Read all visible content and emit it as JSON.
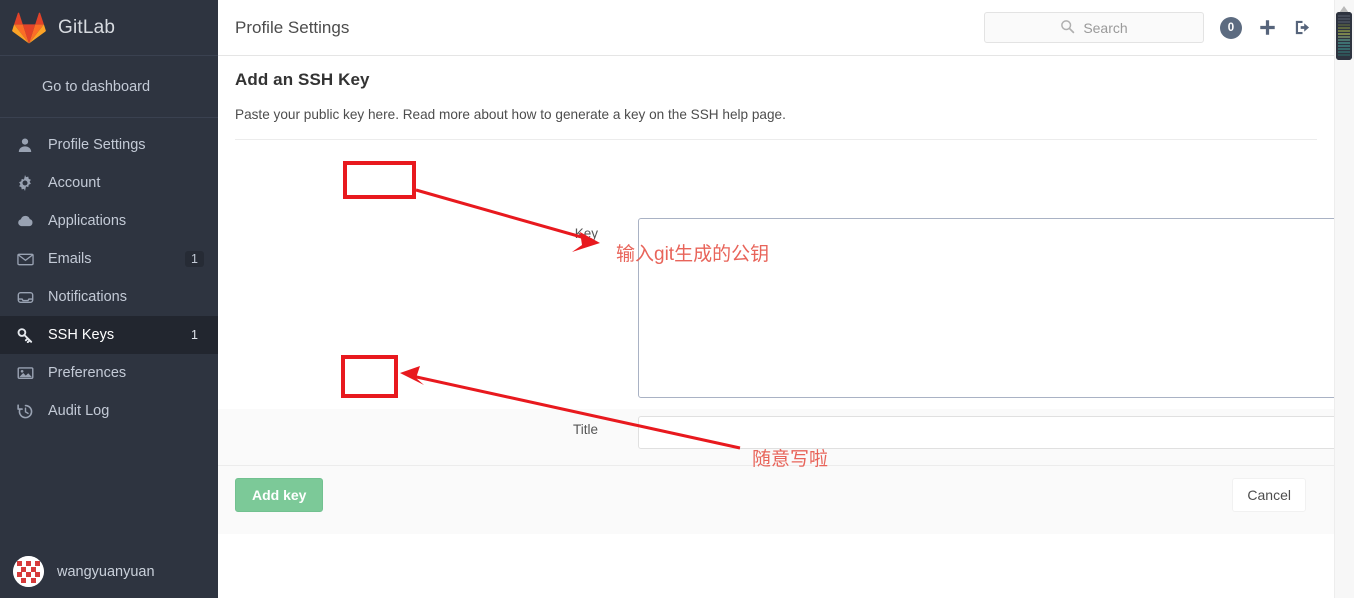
{
  "sidebar": {
    "brand": {
      "name": "GitLab",
      "logo_icon": "gitlab-tanuki-logo"
    },
    "dashboard_link": "Go to dashboard",
    "items": [
      {
        "label": "Profile Settings",
        "icon": "user-icon",
        "badge": "",
        "active": false
      },
      {
        "label": "Account",
        "icon": "gear-icon",
        "badge": "",
        "active": false
      },
      {
        "label": "Applications",
        "icon": "cloud-icon",
        "badge": "",
        "active": false
      },
      {
        "label": "Emails",
        "icon": "envelope-icon",
        "badge": "1",
        "active": false
      },
      {
        "label": "Notifications",
        "icon": "inbox-icon",
        "badge": "",
        "active": false
      },
      {
        "label": "SSH Keys",
        "icon": "key-icon",
        "badge": "1",
        "active": true
      },
      {
        "label": "Preferences",
        "icon": "image-icon",
        "badge": "",
        "active": false
      },
      {
        "label": "Audit Log",
        "icon": "history-icon",
        "badge": "",
        "active": false
      }
    ],
    "user": {
      "name": "wangyuanyuan",
      "avatar_icon": "identicon-avatar"
    }
  },
  "topbar": {
    "page_title": "Profile Settings",
    "search": {
      "placeholder": "Search",
      "value": "",
      "icon": "search-icon"
    },
    "todos_count": "0",
    "new_icon": "plus-icon",
    "signout_icon": "sign-out-icon"
  },
  "main": {
    "heading": "Add an SSH Key",
    "description": "Paste your public key here. Read more about how to generate a key on the SSH help page.",
    "description_link": "the SSH help page",
    "fields": {
      "key": {
        "label": "Key",
        "value": "",
        "placeholder": ""
      },
      "title": {
        "label": "Title",
        "value": "",
        "placeholder": ""
      }
    },
    "buttons": {
      "submit": "Add key",
      "cancel": "Cancel"
    }
  },
  "annotations": [
    {
      "id": "key-note",
      "text": "输入git生成的公钥",
      "color": "#e8645a"
    },
    {
      "id": "title-note",
      "text": "随意写啦",
      "color": "#e8645a"
    }
  ],
  "colors": {
    "sidebar_bg": "#2e3440",
    "sidebar_active": "#22262f",
    "accent_green": "#7cc998",
    "annotation_red": "#e8645a",
    "brand_orange": "#e24329"
  },
  "scrollbar": {
    "position": "top",
    "thumb_icon": "scrollbar-thumb"
  }
}
